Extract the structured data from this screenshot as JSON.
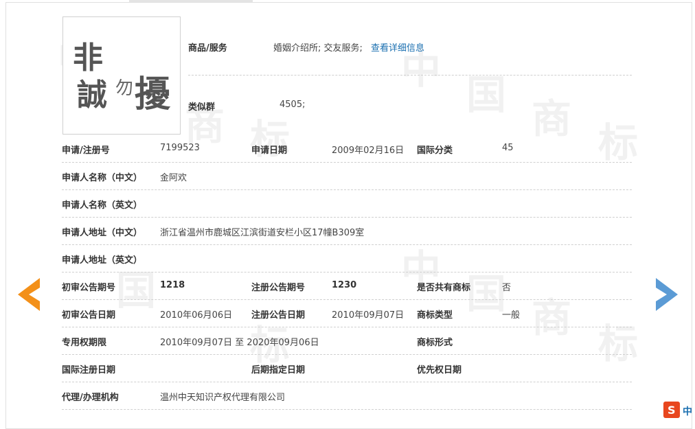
{
  "watermark_char": [
    "中",
    "国",
    "商",
    "标"
  ],
  "logo": {
    "chars": [
      "非",
      "誠",
      "勿",
      "擾"
    ]
  },
  "goods": {
    "label": "商品/服务",
    "value": "婚姻介绍所; 交友服务;",
    "link": "查看详细信息"
  },
  "similar_group": {
    "label": "类似群",
    "value": "4505;"
  },
  "rows": {
    "reg_no_label": "申请/注册号",
    "reg_no": "7199523",
    "apply_date_label": "申请日期",
    "apply_date": "2009年02月16日",
    "intl_class_label": "国际分类",
    "intl_class": "45",
    "applicant_cn_label": "申请人名称（中文）",
    "applicant_cn": "金阿欢",
    "applicant_en_label": "申请人名称（英文）",
    "applicant_en": "",
    "address_cn_label": "申请人地址（中文）",
    "address_cn": "浙江省温州市鹿城区江滨街道安栏小区17幢B309室",
    "address_en_label": "申请人地址（英文）",
    "address_en": "",
    "prelim_no_label": "初审公告期号",
    "prelim_no": "1218",
    "reg_pub_no_label": "注册公告期号",
    "reg_pub_no": "1230",
    "shared_label": "是否共有商标",
    "shared": "否",
    "prelim_date_label": "初审公告日期",
    "prelim_date": "2010年06月06日",
    "reg_pub_date_label": "注册公告日期",
    "reg_pub_date": "2010年09月07日",
    "tm_type_label": "商标类型",
    "tm_type": "一般",
    "exclusive_label": "专用权期限",
    "exclusive": "2010年09月07日 至 2020年09月06日",
    "tm_form_label": "商标形式",
    "tm_form": "",
    "intl_reg_date_label": "国际注册日期",
    "intl_reg_date": "",
    "later_date_label": "后期指定日期",
    "later_date": "",
    "priority_label": "优先权日期",
    "priority": "",
    "agent_label": "代理/办理机构",
    "agent": "温州中天知识产权代理有限公司"
  },
  "nav": {
    "prev_icon": "left-arrow-icon",
    "next_icon": "right-arrow-icon"
  },
  "ime": {
    "icon": "sogou-s-icon",
    "mode_char": "中"
  },
  "colors": {
    "prev_arrow": "#f39019",
    "next_arrow": "#5b9bd5",
    "link": "#1a6fb0",
    "ime": "#e8461e"
  }
}
